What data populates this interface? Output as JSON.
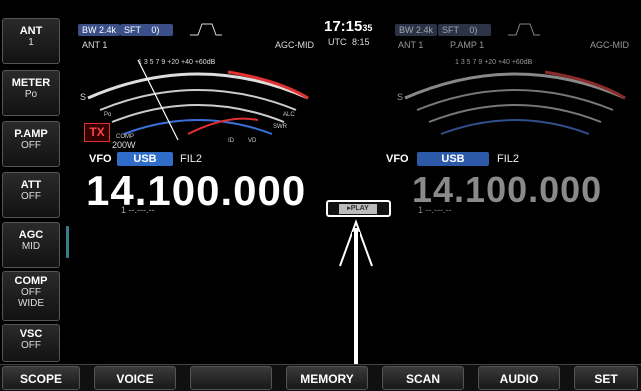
{
  "side_buttons": [
    {
      "title": "ANT",
      "value": "1"
    },
    {
      "title": "METER",
      "value": "Po"
    },
    {
      "title": "P.AMP",
      "value": "OFF"
    },
    {
      "title": "ATT",
      "value": "OFF"
    },
    {
      "title": "AGC",
      "value": "MID"
    },
    {
      "title": "COMP",
      "value": "OFF\nWIDE"
    },
    {
      "title": "VSC",
      "value": "OFF"
    }
  ],
  "main": {
    "bw": "BW 2.4k",
    "sft": "SFT",
    "sft_val": "0)",
    "ant": "ANT 1",
    "agc": "AGC-MID",
    "tx": "TX",
    "power": "200W",
    "vfo": "VFO",
    "mode": "USB",
    "fil": "FIL2",
    "freq": "14.100.000",
    "mem": "1 --.---.--"
  },
  "clock": {
    "time": "17:15",
    "sec": "35",
    "utc_label": "UTC",
    "utc": "8:15"
  },
  "sub": {
    "bw": "BW 2.4k",
    "sft": "SFT",
    "sft_val": "0)",
    "ant": "ANT 1",
    "pamp": "P.AMP 1",
    "agc": "AGC-MID",
    "vfo": "VFO",
    "mode": "USB",
    "fil": "FIL2",
    "freq": "14.100.000",
    "mem": "1 --.---.--"
  },
  "play": "▸PLAY",
  "meter_labels": {
    "s": "S",
    "scale_top": "1  3  5  7  9  +20  +40  +60dB",
    "po": "Po",
    "alc": "ALC",
    "swr": "SWR",
    "comp": "COMP",
    "id": "ID",
    "vd": "VD"
  },
  "fkeys": [
    "SCOPE",
    "VOICE",
    "",
    "MEMORY",
    "SCAN",
    "AUDIO",
    "SET"
  ],
  "colors": {
    "accent": "#2f6dc9",
    "tx": "#ff4040",
    "scale_red": "#e03030",
    "scale_blue": "#3a70d8"
  }
}
